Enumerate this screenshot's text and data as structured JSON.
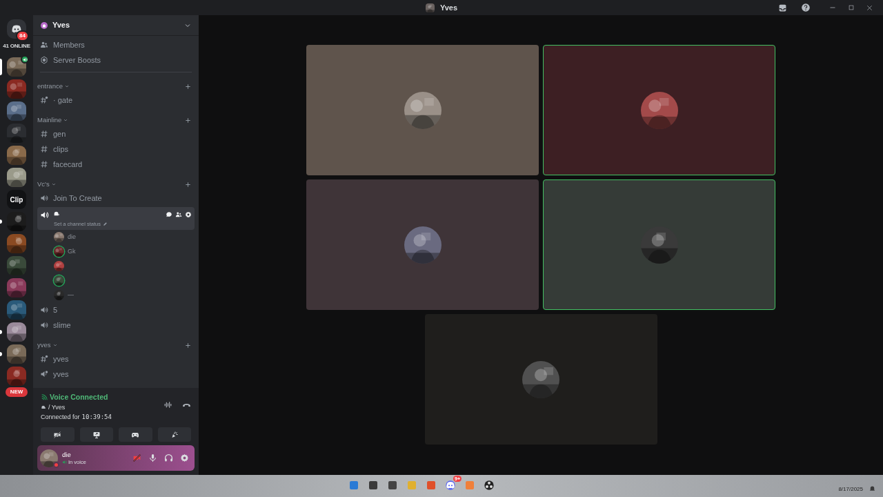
{
  "window": {
    "title": "Yves"
  },
  "home": {
    "badge": "84",
    "online": "41 ONLINE"
  },
  "servers": [
    {
      "kind": "picture",
      "selected": true,
      "unread": false,
      "in_voice": true
    },
    {
      "kind": "picture",
      "selected": false,
      "unread": false,
      "in_voice": false
    },
    {
      "kind": "picture",
      "selected": false,
      "unread": false,
      "in_voice": false
    },
    {
      "kind": "picture",
      "selected": false,
      "unread": false,
      "in_voice": false
    },
    {
      "kind": "picture",
      "selected": false,
      "unread": false,
      "in_voice": false
    },
    {
      "kind": "picture",
      "selected": false,
      "unread": false,
      "in_voice": false
    },
    {
      "kind": "text",
      "label": "Clip",
      "selected": false,
      "unread": false,
      "in_voice": false
    },
    {
      "kind": "picture",
      "selected": false,
      "unread": true,
      "in_voice": false
    },
    {
      "kind": "picture",
      "selected": false,
      "unread": false,
      "in_voice": false
    },
    {
      "kind": "picture",
      "selected": false,
      "unread": false,
      "in_voice": false
    },
    {
      "kind": "picture",
      "selected": false,
      "unread": false,
      "in_voice": false
    },
    {
      "kind": "picture",
      "selected": false,
      "unread": false,
      "in_voice": false
    },
    {
      "kind": "picture",
      "selected": false,
      "unread": true,
      "in_voice": false
    },
    {
      "kind": "picture",
      "selected": false,
      "unread": true,
      "in_voice": false
    },
    {
      "kind": "picture",
      "selected": false,
      "unread": false,
      "in_voice": false,
      "badge": "NEW"
    }
  ],
  "server": {
    "name": "Yves",
    "links": [
      {
        "kind": "members",
        "label": "Members"
      },
      {
        "kind": "boosts",
        "label": "Server Boosts"
      }
    ]
  },
  "categories": [
    {
      "name": "entrance",
      "channels": [
        {
          "kind": "text-private",
          "name": "· gate"
        }
      ]
    },
    {
      "name": "Mainline",
      "channels": [
        {
          "kind": "text",
          "name": "gen"
        },
        {
          "kind": "text",
          "name": "clips"
        },
        {
          "kind": "text",
          "name": "facecard"
        }
      ]
    },
    {
      "name": "Vc's",
      "channels": [
        {
          "kind": "voice",
          "name": "Join To Create"
        },
        {
          "kind": "voice-active",
          "status_placeholder": "Set a channel status",
          "members": [
            {
              "name": "die",
              "speaking": false
            },
            {
              "name": "Gk",
              "speaking": true
            },
            {
              "speaking": false
            },
            {
              "speaking": true
            },
            {
              "name": "—",
              "speaking": false
            }
          ]
        },
        {
          "kind": "voice",
          "name": "5"
        },
        {
          "kind": "voice",
          "name": "slime"
        }
      ]
    },
    {
      "name": "yves",
      "channels": [
        {
          "kind": "text-private",
          "name": "yves"
        },
        {
          "kind": "voice-private",
          "name": "yves"
        }
      ]
    }
  ],
  "voice": {
    "title": "Voice Connected",
    "channel": "/ Yves",
    "connected_label": "Connected for",
    "duration": "10:39:54"
  },
  "user": {
    "name": "die",
    "status": "In voice"
  },
  "tiles": [
    {
      "color": "#5f544c",
      "speaking": false
    },
    {
      "color": "#3d1f23",
      "speaking": true
    },
    {
      "color": "#3f3438",
      "speaking": false
    },
    {
      "color": "#353b37",
      "speaking": true
    },
    {
      "color": "#1f1e1c",
      "speaking": false
    }
  ],
  "taskbar": {
    "discord_badge": "9+",
    "date": "8/17/2025"
  }
}
